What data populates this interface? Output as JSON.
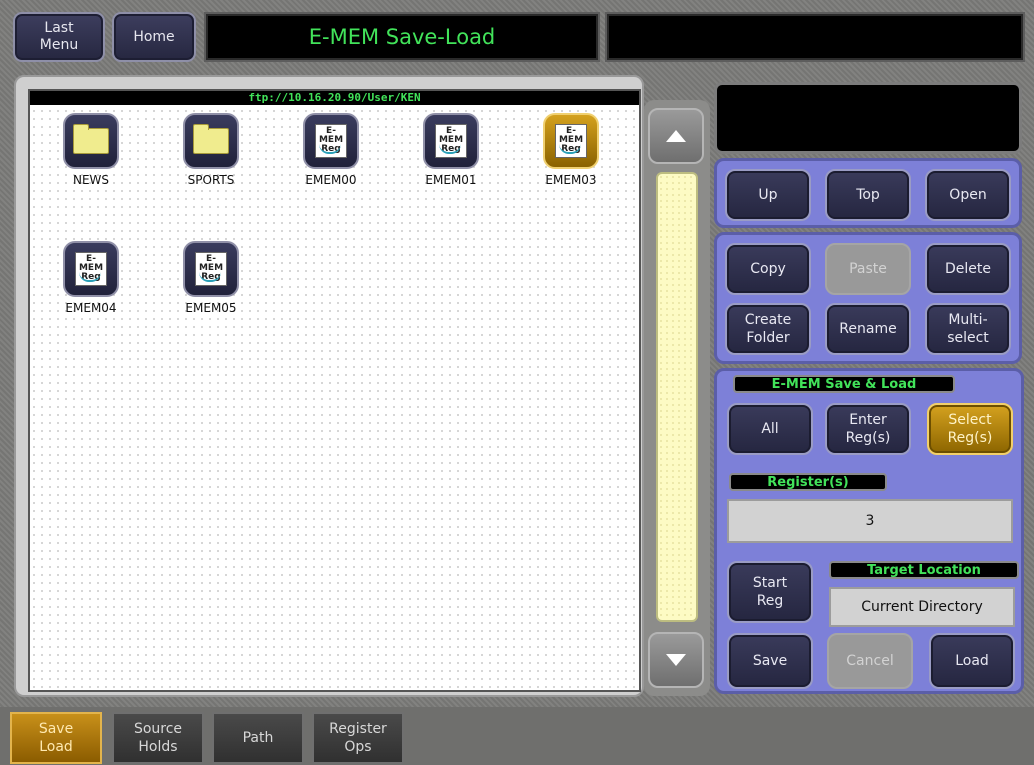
{
  "header": {
    "last_menu": "Last\nMenu",
    "home": "Home",
    "title": "E-MEM Save-Load",
    "status": ""
  },
  "file_browser": {
    "path": "ftp://10.16.20.90/User/KEN",
    "items": [
      {
        "label": "NEWS",
        "type": "folder",
        "selected": false
      },
      {
        "label": "SPORTS",
        "type": "folder",
        "selected": false
      },
      {
        "label": "EMEM00",
        "type": "emem",
        "selected": false
      },
      {
        "label": "EMEM01",
        "type": "emem",
        "selected": false
      },
      {
        "label": "EMEM03",
        "type": "emem",
        "selected": true
      },
      {
        "label": "EMEM04",
        "type": "emem",
        "selected": false
      },
      {
        "label": "EMEM05",
        "type": "emem",
        "selected": false
      }
    ],
    "emem_icon_text": "E-MEM\nReg"
  },
  "nav_buttons": {
    "up": "Up",
    "top": "Top",
    "open": "Open"
  },
  "edit_buttons": {
    "copy": "Copy",
    "paste": "Paste",
    "delete": "Delete",
    "create_folder": "Create\nFolder",
    "rename": "Rename",
    "multi_select": "Multi-\nselect"
  },
  "save_load": {
    "section_label": "E-MEM Save & Load",
    "all": "All",
    "enter_regs": "Enter\nReg(s)",
    "select_regs": "Select\nReg(s)",
    "registers_label": "Register(s)",
    "registers_value": "3",
    "start_reg": "Start\nReg",
    "target_location_label": "Target Location",
    "target_location_value": "Current Directory",
    "save": "Save",
    "cancel": "Cancel",
    "load": "Load"
  },
  "tabs": [
    {
      "label": "Save\nLoad",
      "active": true
    },
    {
      "label": "Source\nHolds",
      "active": false
    },
    {
      "label": "Path",
      "active": false
    },
    {
      "label": "Register\nOps",
      "active": false
    }
  ],
  "colors": {
    "accent_green": "#42e35a",
    "selected_gold": "#d5a21f",
    "panel_blue": "#7d80d8"
  }
}
